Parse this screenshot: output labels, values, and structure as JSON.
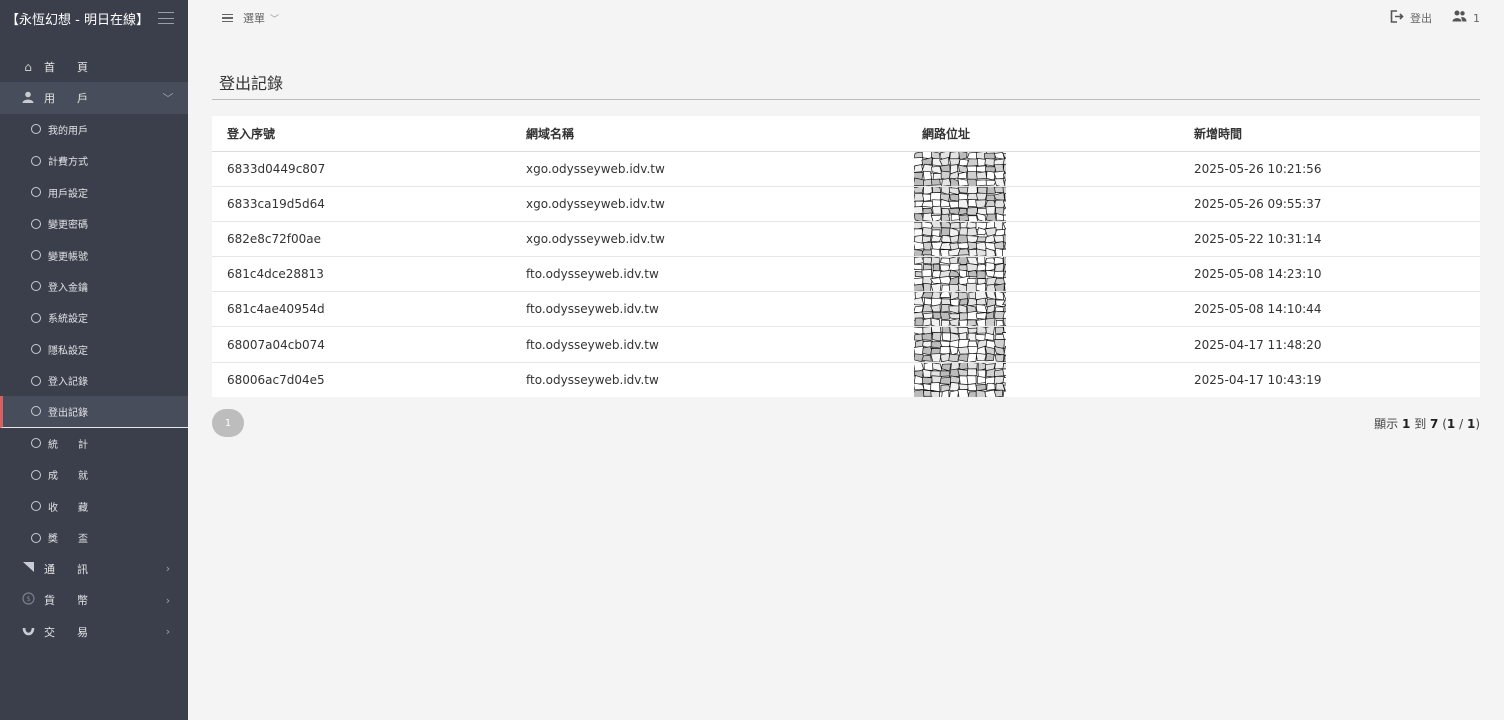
{
  "brand": {
    "title": "【永恆幻想 - 明日在線】"
  },
  "header": {
    "menu_label": "選單",
    "logout_label": "登出",
    "user_count": "1"
  },
  "sidebar": {
    "top_items": [
      {
        "label": "首　　頁",
        "icon": "home-icon"
      },
      {
        "label": "用　　戶",
        "icon": "user-icon"
      }
    ],
    "sub_items": [
      {
        "label": "我的用戶"
      },
      {
        "label": "計費方式"
      },
      {
        "label": "用戶設定"
      },
      {
        "label": "變更密碼"
      },
      {
        "label": "變更帳號"
      },
      {
        "label": "登入金鑰"
      },
      {
        "label": "系統設定"
      },
      {
        "label": "隱私設定"
      },
      {
        "label": "登入記錄"
      },
      {
        "label": "登出記錄"
      },
      {
        "label": "統　　計"
      },
      {
        "label": "成　　就"
      },
      {
        "label": "收　　藏"
      },
      {
        "label": "獎　　盃"
      }
    ],
    "bottom_items": [
      {
        "label": "通　　訊",
        "icon": "megaphone-icon"
      },
      {
        "label": "貨　　幣",
        "icon": "coin-icon"
      },
      {
        "label": "交　　易",
        "icon": "magnet-icon"
      }
    ]
  },
  "main": {
    "page_title": "登出記錄",
    "columns": [
      "登入序號",
      "網域名稱",
      "網路位址",
      "新增時間"
    ],
    "rows": [
      {
        "id": "6833d0449c807",
        "domain": "xgo.odysseyweb.idv.tw",
        "time": "2025-05-26 10:21:56"
      },
      {
        "id": "6833ca19d5d64",
        "domain": "xgo.odysseyweb.idv.tw",
        "time": "2025-05-26 09:55:37"
      },
      {
        "id": "682e8c72f00ae",
        "domain": "xgo.odysseyweb.idv.tw",
        "time": "2025-05-22 10:31:14"
      },
      {
        "id": "681c4dce28813",
        "domain": "fto.odysseyweb.idv.tw",
        "time": "2025-05-08 14:23:10"
      },
      {
        "id": "681c4ae40954d",
        "domain": "fto.odysseyweb.idv.tw",
        "time": "2025-05-08 14:10:44"
      },
      {
        "id": "68007a04cb074",
        "domain": "fto.odysseyweb.idv.tw",
        "time": "2025-04-17 11:48:20"
      },
      {
        "id": "68006ac7d04e5",
        "domain": "fto.odysseyweb.idv.tw",
        "time": "2025-04-17 10:43:19"
      }
    ],
    "pagination": {
      "current": "1"
    },
    "summary": {
      "prefix": "顯示",
      "from": "1",
      "to_word": "到",
      "to": "7",
      "page": "1",
      "pages": "1"
    }
  },
  "colors": {
    "sidebar_bg": "#3a3f4b",
    "active_accent": "#e45b5b",
    "page_bg": "#f4f4f4"
  }
}
